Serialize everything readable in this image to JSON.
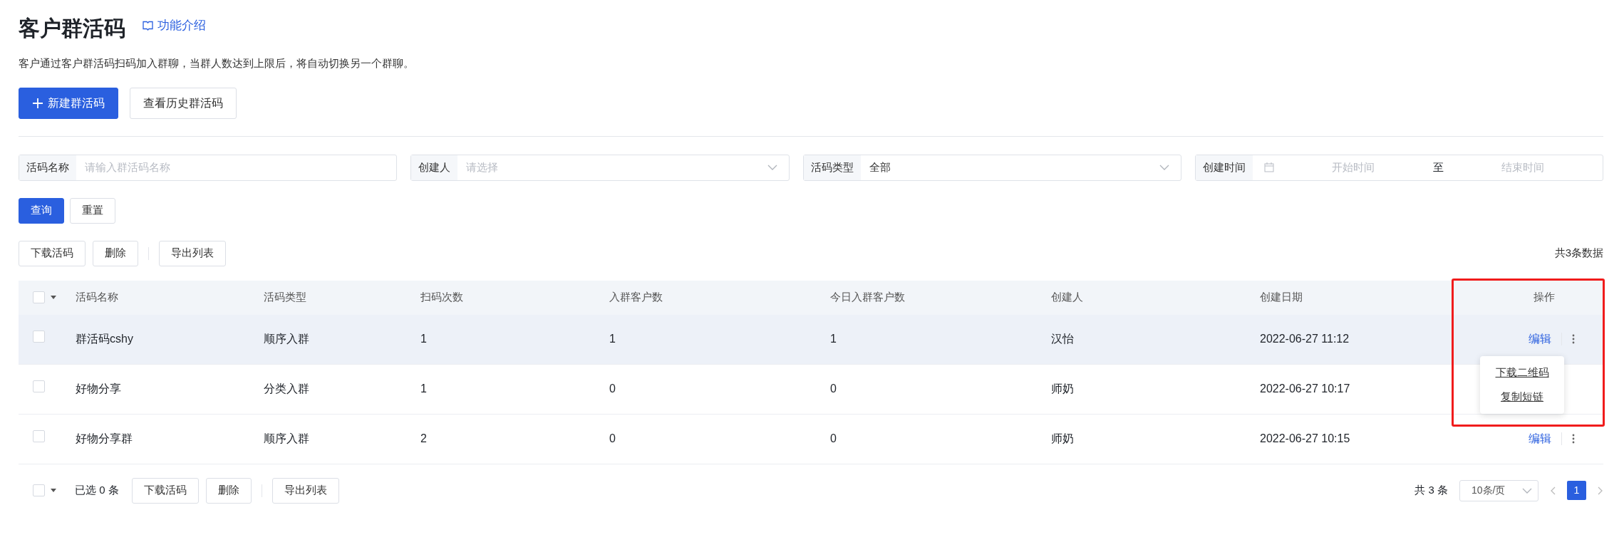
{
  "page": {
    "title": "客户群活码",
    "help_link": "功能介绍",
    "description": "客户通过客户群活码扫码加入群聊，当群人数达到上限后，将自动切换另一个群聊。"
  },
  "actions": [
    {
      "label": "新建群活码",
      "kind": "primary"
    },
    {
      "label": "查看历史群活码",
      "kind": "default"
    }
  ],
  "filters": [
    {
      "kind": "input",
      "label": "活码名称",
      "placeholder": "请输入群活码名称"
    },
    {
      "kind": "select",
      "label": "创建人",
      "placeholder": "请选择"
    },
    {
      "kind": "select",
      "label": "活码类型",
      "value": "全部"
    },
    {
      "kind": "daterange",
      "label": "创建时间",
      "start_placeholder": "开始时间",
      "separator": "至",
      "end_placeholder": "结束时间"
    }
  ],
  "filter_buttons": [
    {
      "label": "查询",
      "kind": "primary"
    },
    {
      "label": "重置",
      "kind": "default"
    }
  ],
  "toolbar": {
    "buttons": [
      "下载活码",
      "删除",
      "导出列表"
    ],
    "total": "共3条数据"
  },
  "table": {
    "all_checked": false,
    "columns": [
      "活码名称",
      "活码类型",
      "扫码次数",
      "入群客户数",
      "今日入群客户数",
      "创建人",
      "创建日期",
      "操作"
    ],
    "rows": [
      {
        "cells": [
          "群活码cshy",
          "顺序入群",
          "1",
          "1",
          "1",
          "汉怡",
          "2022-06-27 11:12"
        ],
        "edit": "编辑",
        "checked": false,
        "hovered": true,
        "menu": [
          "下载二维码",
          "复制短链"
        ]
      },
      {
        "cells": [
          "好物分享",
          "分类入群",
          "1",
          "0",
          "0",
          "师奶",
          "2022-06-27 10:17"
        ],
        "checked": false,
        "hovered": false
      },
      {
        "cells": [
          "好物分享群",
          "顺序入群",
          "2",
          "0",
          "0",
          "师奶",
          "2022-06-27 10:15"
        ],
        "edit": "编辑",
        "checked": false,
        "hovered": false
      }
    ]
  },
  "footer": {
    "all_checked": false,
    "selected": "已选 0 条",
    "buttons": [
      "下载活码",
      "删除",
      "导出列表"
    ],
    "total": "共 3 条",
    "page_size": "10条/页",
    "pages": [
      {
        "label": "1",
        "selected": true
      }
    ]
  }
}
